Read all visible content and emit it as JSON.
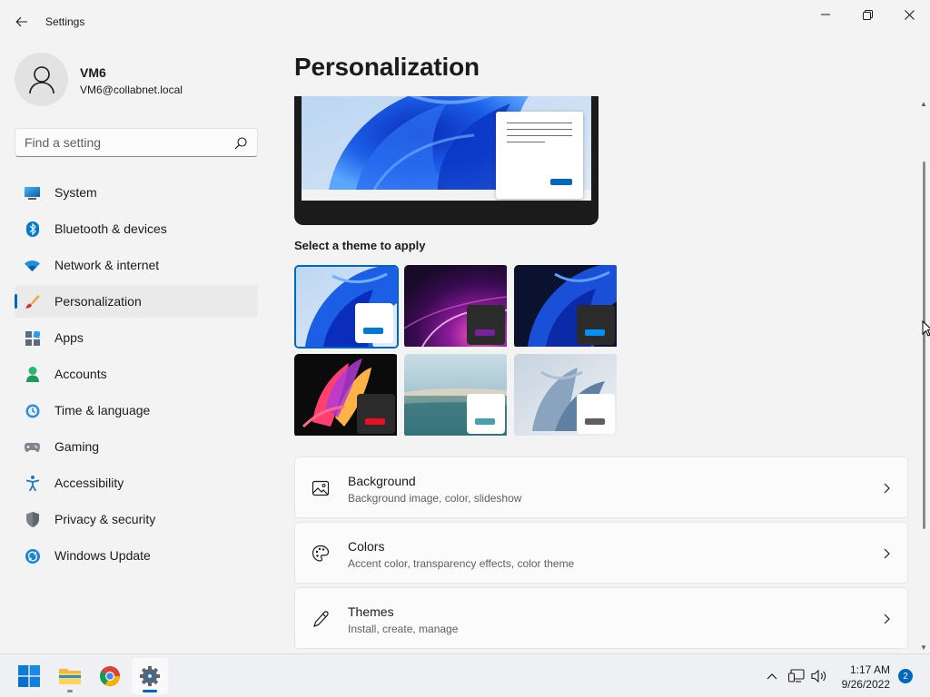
{
  "window": {
    "title": "Settings",
    "controls": {
      "minimize": "minimize-icon",
      "maximize": "restore-icon",
      "close": "close-icon"
    }
  },
  "profile": {
    "name": "VM6",
    "email": "VM6@collabnet.local"
  },
  "search": {
    "placeholder": "Find a setting"
  },
  "sidebar": {
    "items": [
      {
        "label": "System",
        "icon": "system-icon"
      },
      {
        "label": "Bluetooth & devices",
        "icon": "bluetooth-icon"
      },
      {
        "label": "Network & internet",
        "icon": "wifi-icon"
      },
      {
        "label": "Personalization",
        "icon": "brush-icon",
        "active": true
      },
      {
        "label": "Apps",
        "icon": "apps-icon"
      },
      {
        "label": "Accounts",
        "icon": "accounts-icon"
      },
      {
        "label": "Time & language",
        "icon": "clock-globe-icon"
      },
      {
        "label": "Gaming",
        "icon": "gamepad-icon"
      },
      {
        "label": "Accessibility",
        "icon": "accessibility-icon"
      },
      {
        "label": "Privacy & security",
        "icon": "shield-icon"
      },
      {
        "label": "Windows Update",
        "icon": "update-icon"
      }
    ]
  },
  "main": {
    "title": "Personalization",
    "themes_label": "Select a theme to apply",
    "themes": [
      {
        "name": "windows-light",
        "selected": true,
        "window_color": "#ffffff",
        "accent": "#0078d4"
      },
      {
        "name": "glow",
        "selected": false,
        "window_color": "#2b2b2b",
        "accent": "#7b1fa2"
      },
      {
        "name": "windows-dark",
        "selected": false,
        "window_color": "#2b2b2b",
        "accent": "#0091f8"
      },
      {
        "name": "captured-motion",
        "selected": false,
        "window_color": "#2b2b2b",
        "accent": "#e81123"
      },
      {
        "name": "flow",
        "selected": false,
        "window_color": "#ffffff",
        "accent": "#4a9fb0"
      },
      {
        "name": "sunrise",
        "selected": false,
        "window_color": "#ffffff",
        "accent": "#5e5e5e"
      }
    ],
    "cards": [
      {
        "title": "Background",
        "subtitle": "Background image, color, slideshow",
        "icon": "image-icon"
      },
      {
        "title": "Colors",
        "subtitle": "Accent color, transparency effects, color theme",
        "icon": "palette-icon"
      },
      {
        "title": "Themes",
        "subtitle": "Install, create, manage",
        "icon": "pen-icon"
      }
    ]
  },
  "taskbar": {
    "apps": [
      "start-icon",
      "file-explorer-icon",
      "chrome-icon",
      "settings-icon"
    ],
    "clock": {
      "time": "1:17 AM",
      "date": "9/26/2022"
    },
    "notifications": "2"
  },
  "colors": {
    "accent": "#0067c0",
    "background": "#f3f3f3",
    "card": "#fbfbfb"
  }
}
